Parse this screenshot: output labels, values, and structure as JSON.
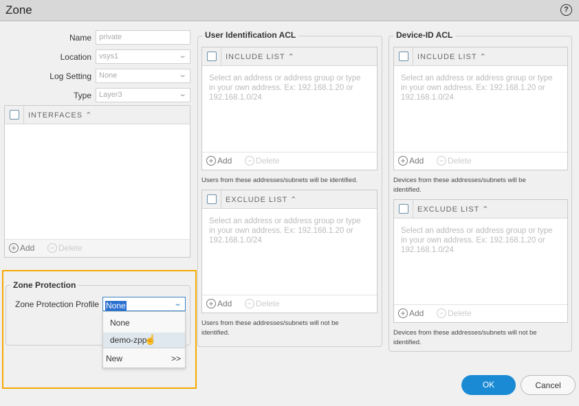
{
  "dialog": {
    "title": "Zone",
    "help_icon": "help-circle-icon"
  },
  "general": {
    "name_label": "Name",
    "name_value": "private",
    "location_label": "Location",
    "location_value": "vsys1",
    "log_setting_label": "Log Setting",
    "log_setting_value": "None",
    "type_label": "Type",
    "type_value": "Layer3"
  },
  "interfaces": {
    "header": "INTERFACES",
    "add": "Add",
    "delete": "Delete"
  },
  "zone_protection": {
    "legend": "Zone Protection",
    "profile_label": "Zone Protection Profile",
    "profile_value": "None",
    "options": [
      "None",
      "demo-zpp"
    ],
    "new_label": "New",
    "new_arrow": ">>",
    "highlight_color": "#f5a800"
  },
  "user_acl": {
    "legend": "User Identification ACL",
    "include": {
      "header": "INCLUDE LIST",
      "placeholder": "Select an address or address group or type in your own address. Ex: 192.168.1.20 or 192.168.1.0/24",
      "add": "Add",
      "delete": "Delete"
    },
    "include_note": "Users from these addresses/subnets will be identified.",
    "exclude": {
      "header": "EXCLUDE LIST",
      "placeholder": "Select an address or address group or type in your own address. Ex: 192.168.1.20 or 192.168.1.0/24",
      "add": "Add",
      "delete": "Delete"
    },
    "exclude_note": "Users from these addresses/subnets will not be identified."
  },
  "device_acl": {
    "legend": "Device-ID ACL",
    "include": {
      "header": "INCLUDE LIST",
      "placeholder": "Select an address or address group or type in your own address. Ex: 192.168.1.20 or 192.168.1.0/24",
      "add": "Add",
      "delete": "Delete"
    },
    "include_note": "Devices from these addresses/subnets will be identified.",
    "exclude": {
      "header": "EXCLUDE LIST",
      "placeholder": "Select an address or address group or type in your own address. Ex: 192.168.1.20 or 192.168.1.0/24",
      "add": "Add",
      "delete": "Delete"
    },
    "exclude_note": "Devices from these addresses/subnets will not be identified."
  },
  "buttons": {
    "ok": "OK",
    "cancel": "Cancel",
    "ok_color": "#1a8ad4"
  }
}
